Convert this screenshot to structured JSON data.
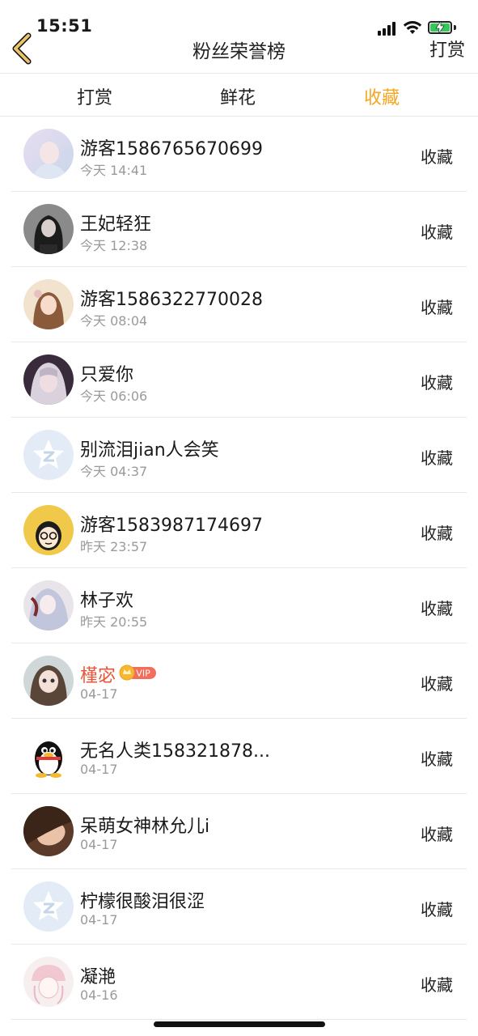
{
  "status_bar": {
    "time": "15:51"
  },
  "nav": {
    "title": "粉丝荣誉榜",
    "action": "打赏"
  },
  "tabs": [
    {
      "label": "打赏",
      "active": false
    },
    {
      "label": "鲜花",
      "active": false
    },
    {
      "label": "收藏",
      "active": true
    }
  ],
  "colors": {
    "accent": "#f5a623",
    "vip_name": "#e8553a",
    "secondary_text": "#9a9a9a"
  },
  "rows": [
    {
      "name": "游客1586765670699",
      "date": "今天 14:41",
      "action": "收藏",
      "avatar": "photo-pastel"
    },
    {
      "name": "王妃轻狂",
      "date": "今天 12:38",
      "action": "收藏",
      "avatar": "photo-dark-hair"
    },
    {
      "name": "游客1586322770028",
      "date": "今天 08:04",
      "action": "收藏",
      "avatar": "photo-warm"
    },
    {
      "name": "只爱你",
      "date": "今天 06:06",
      "action": "收藏",
      "avatar": "photo-purple"
    },
    {
      "name": "别流泪jian人会笑",
      "date": "今天 04:37",
      "action": "收藏",
      "avatar": "default-star"
    },
    {
      "name": "游客1583987174697",
      "date": "昨天 23:57",
      "action": "收藏",
      "avatar": "cartoon-glasses"
    },
    {
      "name": "林子欢",
      "date": "昨天 20:55",
      "action": "收藏",
      "avatar": "photo-anime"
    },
    {
      "name": "槿宓",
      "date": "04-17",
      "action": "收藏",
      "avatar": "photo-doll",
      "vip": true,
      "vip_label": "VIP"
    },
    {
      "name": "无名人类158321878...",
      "date": "04-17",
      "action": "收藏",
      "avatar": "penguin"
    },
    {
      "name": "呆萌女神林允儿i",
      "date": "04-17",
      "action": "收藏",
      "avatar": "photo-sleep"
    },
    {
      "name": "柠檬很酸泪很涩",
      "date": "04-17",
      "action": "收藏",
      "avatar": "default-star"
    },
    {
      "name": "凝滟",
      "date": "04-16",
      "action": "收藏",
      "avatar": "photo-sketch"
    }
  ]
}
